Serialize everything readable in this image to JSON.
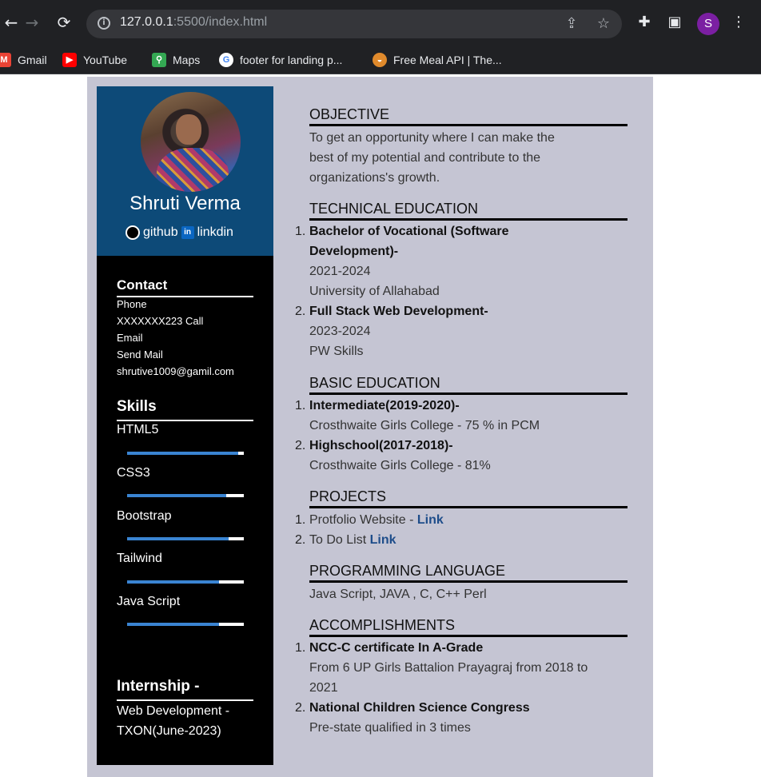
{
  "browser": {
    "url_host": "127.0.0.1",
    "url_rest": ":5500/index.html",
    "profile_initial": "S",
    "bookmarks": [
      {
        "label": "Gmail",
        "icon": "gmail-icon"
      },
      {
        "label": "YouTube",
        "icon": "youtube-icon"
      },
      {
        "label": "Maps",
        "icon": "maps-icon"
      },
      {
        "label": "footer for landing p...",
        "icon": "google-icon"
      },
      {
        "label": "Free Meal API | The...",
        "icon": "meal-icon"
      }
    ]
  },
  "profile": {
    "name": "Shruti Verma",
    "github_label": "github",
    "linkedin_label": "linkdin"
  },
  "contact": {
    "heading": "Contact",
    "lines": [
      "Phone",
      "XXXXXXX223 Call",
      "Email",
      "Send Mail",
      "shrutive1009@gamil.com"
    ]
  },
  "skills": {
    "heading": "Skills",
    "items": [
      {
        "name": "HTML5",
        "level": 0.95
      },
      {
        "name": "CSS3",
        "level": 0.85
      },
      {
        "name": "Bootstrap",
        "level": 0.87
      },
      {
        "name": "Tailwind",
        "level": 0.79
      },
      {
        "name": "Java Script",
        "level": 0.79
      }
    ]
  },
  "internship": {
    "heading": "Internship -",
    "line1": "Web Development -",
    "line2": "TXON(June-2023)"
  },
  "objective": {
    "heading": "OBJECTIVE",
    "lines": [
      "To get an opportunity where I can make the",
      "best of my potential and contribute to the",
      "organizations's growth."
    ]
  },
  "technical_education": {
    "heading": "TECHNICAL EDUCATION",
    "items": [
      {
        "num": "1.",
        "title1": "Bachelor of Vocational (Software",
        "title2": "Development)-",
        "years": "2021-2024",
        "place": "University of Allahabad"
      },
      {
        "num": "2.",
        "title1": "Full Stack Web Development-",
        "years": "2023-2024",
        "place": "PW Skills"
      }
    ]
  },
  "basic_education": {
    "heading": "BASIC EDUCATION",
    "items": [
      {
        "num": "1.",
        "title": "Intermediate(2019-2020)-",
        "detail": "Crosthwaite Girls College - 75 % in PCM"
      },
      {
        "num": "2.",
        "title": "Highschool(2017-2018)-",
        "detail": "Crosthwaite Girls College - 81%"
      }
    ]
  },
  "projects": {
    "heading": "PROJECTS",
    "items": [
      {
        "num": "1.",
        "text": "Protfolio Website - ",
        "link": "Link"
      },
      {
        "num": "2.",
        "text": "To Do List ",
        "link": "Link"
      }
    ]
  },
  "programming": {
    "heading": "PROGRAMMING LANGUAGE",
    "text": "Java Script, JAVA , C, C++ Perl"
  },
  "accomplishments": {
    "heading": "ACCOMPLISHMENTS",
    "items": [
      {
        "num": "1.",
        "title": "NCC-C certificate In A-Grade",
        "detail1": "From 6 UP Girls Battalion Prayagraj from 2018 to",
        "detail2": "2021"
      },
      {
        "num": "2.",
        "title": "National Children Science Congress",
        "detail1": "Pre-state qualified in 3 times"
      }
    ]
  }
}
